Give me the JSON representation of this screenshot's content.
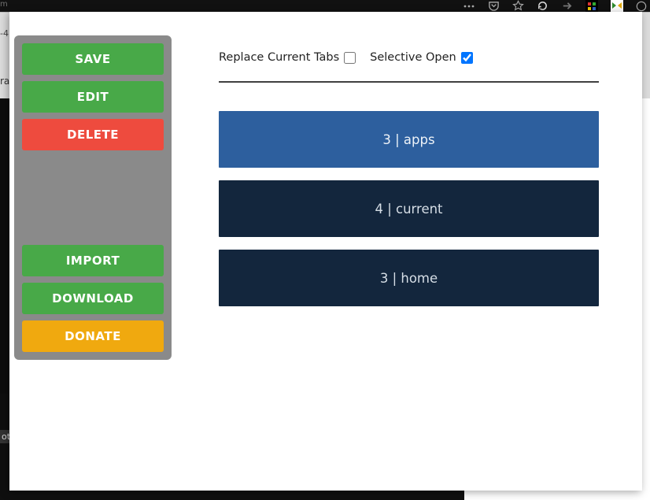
{
  "topbar": {
    "left_fragment": "m"
  },
  "background": {
    "blur1": "-4",
    "blur2": "ra",
    "lower_label": "ot"
  },
  "sidebar": {
    "save": "SAVE",
    "edit": "EDIT",
    "del": "DELETE",
    "import": "IMPORT",
    "download": "DOWNLOAD",
    "donate": "DONATE"
  },
  "options": {
    "replace_label": "Replace Current Tabs",
    "replace_checked": false,
    "selective_label": "Selective Open",
    "selective_checked": true
  },
  "groups": [
    {
      "count": 3,
      "name": "apps",
      "selected": true
    },
    {
      "count": 4,
      "name": "current",
      "selected": false
    },
    {
      "count": 3,
      "name": "home",
      "selected": false
    }
  ]
}
